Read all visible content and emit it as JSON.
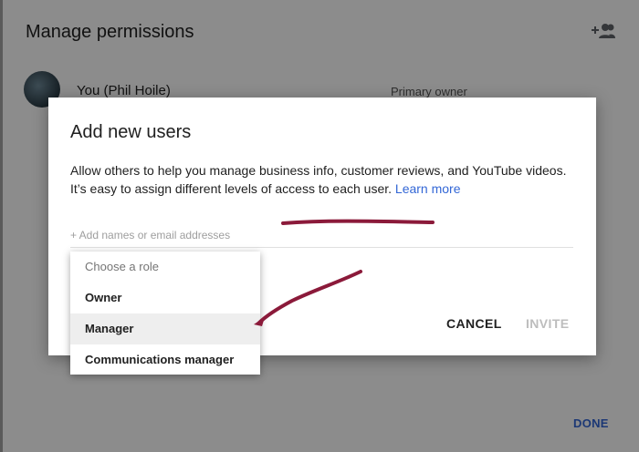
{
  "background": {
    "title": "Manage permissions",
    "add_person_icon": "person-add-icon",
    "user_name": "You (Phil Hoile)",
    "user_role": "Primary owner",
    "done_label": "DONE"
  },
  "dialog": {
    "title": "Add new users",
    "description_line1": "Allow others to help you manage business info, customer reviews, and YouTube videos.",
    "description_line2": "It’s easy to assign different levels of access to each user.",
    "learn_more": "Learn more",
    "email_placeholder": "+ Add names or email addresses",
    "cancel_label": "CANCEL",
    "invite_label": "INVITE"
  },
  "role_menu": {
    "header": "Choose a role",
    "options": [
      "Owner",
      "Manager",
      "Communications manager"
    ],
    "highlighted": "Manager"
  },
  "colors": {
    "accent": "#3367d6",
    "annotation": "#8b1a3a"
  }
}
